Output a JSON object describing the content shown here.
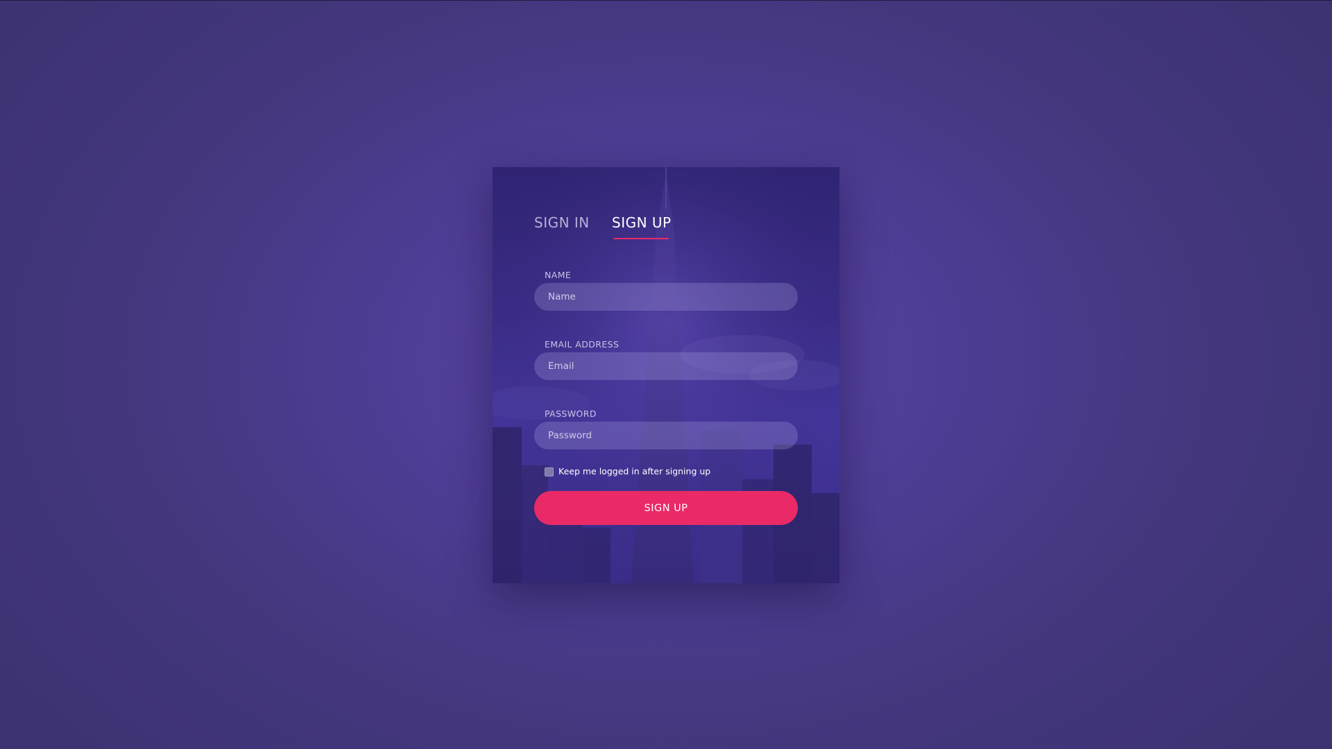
{
  "tabs": {
    "sign_in": "SIGN IN",
    "sign_up": "SIGN UP",
    "active": "SIGN UP"
  },
  "form": {
    "name": {
      "label": "NAME",
      "placeholder": "Name",
      "value": ""
    },
    "email": {
      "label": "EMAIL ADDRESS",
      "placeholder": "Email",
      "value": ""
    },
    "password": {
      "label": "PASSWORD",
      "placeholder": "Password",
      "value": ""
    },
    "keep_logged_in": {
      "label": "Keep me logged in after signing up",
      "checked": false
    },
    "submit_label": "SIGN UP"
  },
  "colors": {
    "accent": "#ea2a66",
    "background": "#4f3d95",
    "card": "#3a2c86"
  }
}
